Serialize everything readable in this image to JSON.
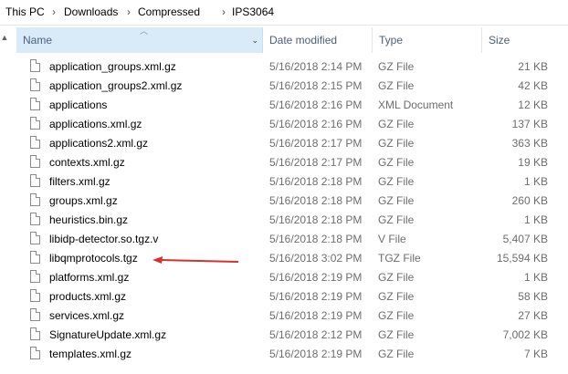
{
  "breadcrumb": {
    "items": [
      "This PC",
      "Downloads",
      "Compressed",
      "IPS3064"
    ],
    "separator": "›"
  },
  "columns": {
    "name": "Name",
    "date": "Date modified",
    "type": "Type",
    "size": "Size"
  },
  "files": [
    {
      "name": "application_groups.xml.gz",
      "date": "5/16/2018 2:14 PM",
      "type": "GZ File",
      "size": "21 KB"
    },
    {
      "name": "application_groups2.xml.gz",
      "date": "5/16/2018 2:15 PM",
      "type": "GZ File",
      "size": "42 KB"
    },
    {
      "name": "applications",
      "date": "5/16/2018 2:16 PM",
      "type": "XML Document",
      "size": "12 KB"
    },
    {
      "name": "applications.xml.gz",
      "date": "5/16/2018 2:16 PM",
      "type": "GZ File",
      "size": "137 KB"
    },
    {
      "name": "applications2.xml.gz",
      "date": "5/16/2018 2:17 PM",
      "type": "GZ File",
      "size": "363 KB"
    },
    {
      "name": "contexts.xml.gz",
      "date": "5/16/2018 2:17 PM",
      "type": "GZ File",
      "size": "19 KB"
    },
    {
      "name": "filters.xml.gz",
      "date": "5/16/2018 2:18 PM",
      "type": "GZ File",
      "size": "1 KB"
    },
    {
      "name": "groups.xml.gz",
      "date": "5/16/2018 2:18 PM",
      "type": "GZ File",
      "size": "260 KB"
    },
    {
      "name": "heuristics.bin.gz",
      "date": "5/16/2018 2:18 PM",
      "type": "GZ File",
      "size": "1 KB"
    },
    {
      "name": "libidp-detector.so.tgz.v",
      "date": "5/16/2018 2:18 PM",
      "type": "V File",
      "size": "5,407 KB"
    },
    {
      "name": "libqmprotocols.tgz",
      "date": "5/16/2018 3:02 PM",
      "type": "TGZ File",
      "size": "15,594 KB"
    },
    {
      "name": "platforms.xml.gz",
      "date": "5/16/2018 2:19 PM",
      "type": "GZ File",
      "size": "1 KB"
    },
    {
      "name": "products.xml.gz",
      "date": "5/16/2018 2:19 PM",
      "type": "GZ File",
      "size": "58 KB"
    },
    {
      "name": "services.xml.gz",
      "date": "5/16/2018 2:19 PM",
      "type": "GZ File",
      "size": "27 KB"
    },
    {
      "name": "SignatureUpdate.xml.gz",
      "date": "5/16/2018 2:12 PM",
      "type": "GZ File",
      "size": "7,002 KB"
    },
    {
      "name": "templates.xml.gz",
      "date": "5/16/2018 2:19 PM",
      "type": "GZ File",
      "size": "7 KB"
    }
  ],
  "colors": {
    "header_selected": "#d9ebf9",
    "header_text": "#4c607a",
    "annotation_arrow": "#d9302b"
  },
  "icons": {
    "file": "file-icon",
    "scroll_up": "scroll-up-icon",
    "sort": "sort-ascending-icon",
    "dropdown": "chevron-down-icon",
    "annotation": "red-arrow-icon"
  }
}
